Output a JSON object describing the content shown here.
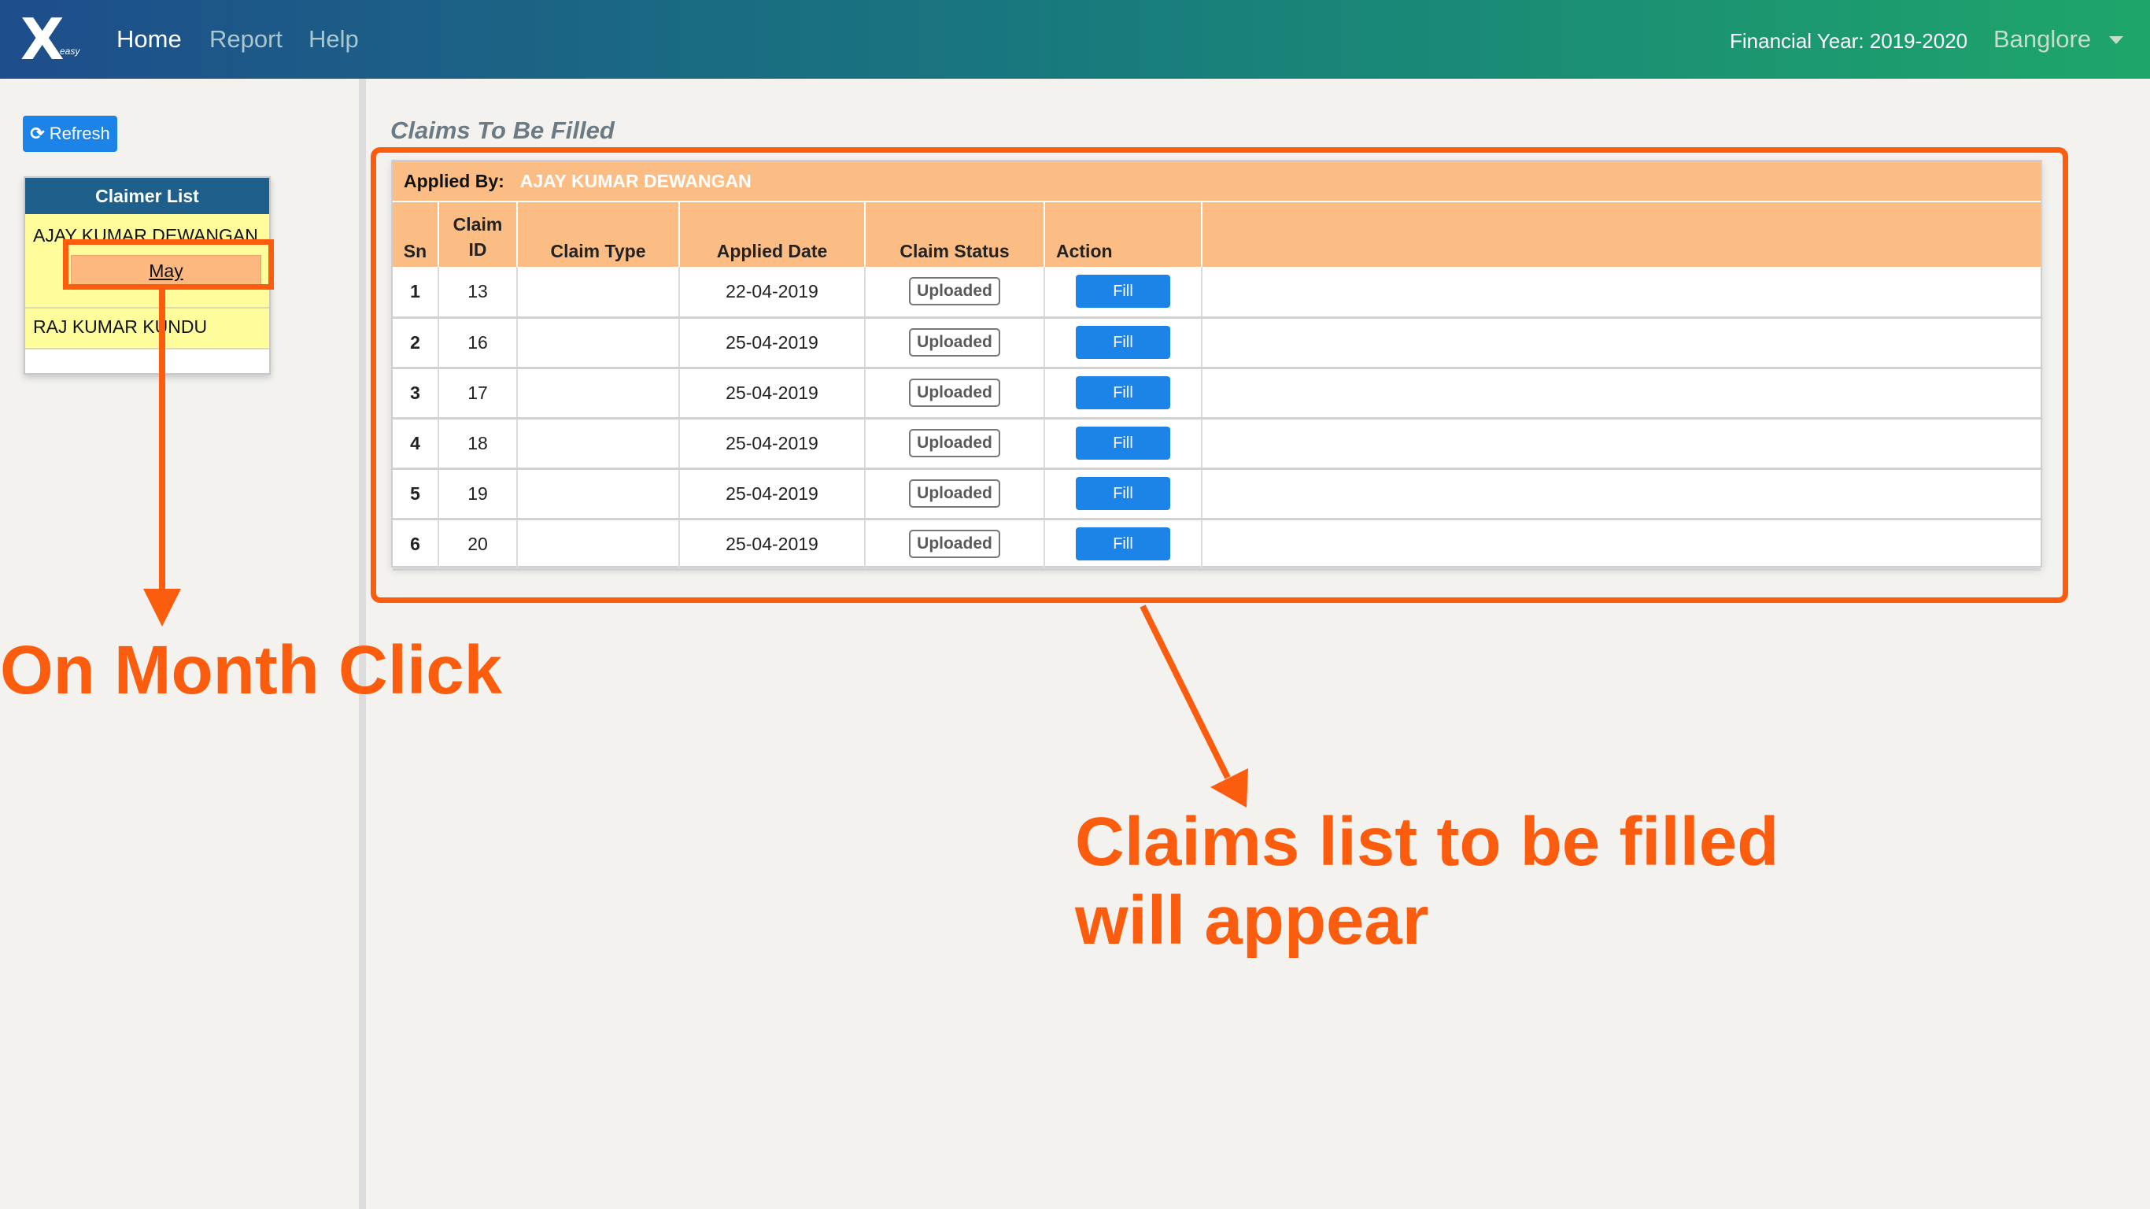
{
  "nav": {
    "logo_text": "X",
    "logo_sub": "easy",
    "home": "Home",
    "report": "Report",
    "help": "Help",
    "financial_year": "Financial Year: 2019-2020",
    "city": "Banglore"
  },
  "sidebar": {
    "refresh_label": "Refresh",
    "claimer_list_title": "Claimer List",
    "claimers": [
      {
        "name": "AJAY KUMAR DEWANGAN",
        "month": "May"
      },
      {
        "name": "RAJ KUMAR KUNDU"
      }
    ]
  },
  "main": {
    "section_title": "Claims To Be Filled",
    "applied_by_label": "Applied By:",
    "applied_by_name": "AJAY KUMAR DEWANGAN",
    "columns": [
      "Sn",
      "Claim ID",
      "Claim Type",
      "Applied Date",
      "Claim Status",
      "Action"
    ],
    "rows": [
      {
        "sn": "1",
        "claim_id": "13",
        "claim_type": "",
        "applied_date": "22-04-2019",
        "status": "Uploaded",
        "action": "Fill"
      },
      {
        "sn": "2",
        "claim_id": "16",
        "claim_type": "",
        "applied_date": "25-04-2019",
        "status": "Uploaded",
        "action": "Fill"
      },
      {
        "sn": "3",
        "claim_id": "17",
        "claim_type": "",
        "applied_date": "25-04-2019",
        "status": "Uploaded",
        "action": "Fill"
      },
      {
        "sn": "4",
        "claim_id": "18",
        "claim_type": "",
        "applied_date": "25-04-2019",
        "status": "Uploaded",
        "action": "Fill"
      },
      {
        "sn": "5",
        "claim_id": "19",
        "claim_type": "",
        "applied_date": "25-04-2019",
        "status": "Uploaded",
        "action": "Fill"
      },
      {
        "sn": "6",
        "claim_id": "20",
        "claim_type": "",
        "applied_date": "25-04-2019",
        "status": "Uploaded",
        "action": "Fill"
      }
    ]
  },
  "annotations": {
    "month_click": "On Month Click",
    "claims_line1": "Claims list to be filled",
    "claims_line2": "will appear",
    "color": "#fb5c0e"
  },
  "colors": {
    "accent_blue": "#1c84e8",
    "header_orange": "#fcbd84",
    "claimer_head": "#1e5f8c",
    "claimer_row": "#fffd9b"
  },
  "icons": {
    "refresh": "refresh-icon",
    "dropdown": "caret-down-icon"
  }
}
